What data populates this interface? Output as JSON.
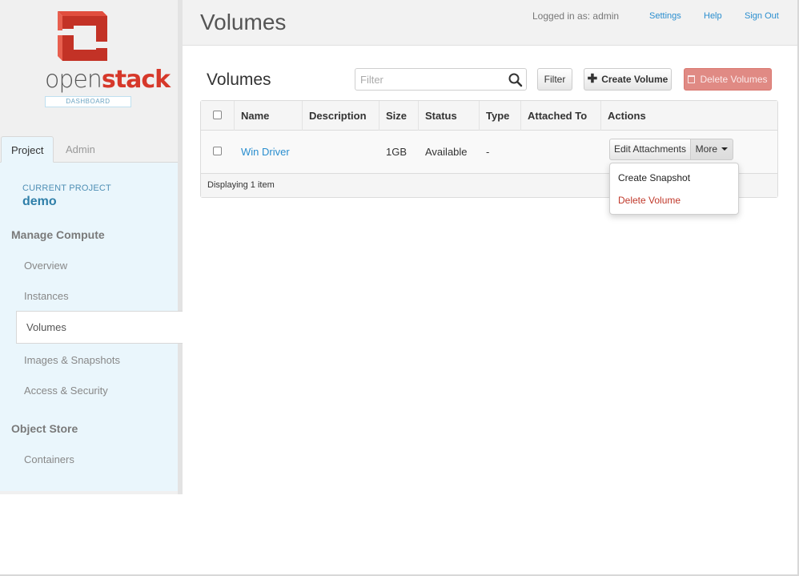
{
  "brand": {
    "logo_word_open": "open",
    "logo_word_stack": "stack",
    "logo_sub": "DASHBOARD",
    "brand_red": "#d6382a"
  },
  "sidebar": {
    "tabs": [
      {
        "label": "Project",
        "active": true
      },
      {
        "label": "Admin",
        "active": false
      }
    ],
    "current_project_label": "CURRENT PROJECT",
    "current_project_name": "demo",
    "sections": [
      {
        "title": "Manage Compute",
        "items": [
          {
            "label": "Overview",
            "active": false
          },
          {
            "label": "Instances",
            "active": false
          },
          {
            "label": "Volumes",
            "active": true
          },
          {
            "label": "Images & Snapshots",
            "active": false
          },
          {
            "label": "Access & Security",
            "active": false
          }
        ]
      },
      {
        "title": "Object Store",
        "items": [
          {
            "label": "Containers",
            "active": false
          }
        ]
      }
    ]
  },
  "header": {
    "title": "Volumes",
    "logged_in": "Logged in as: admin",
    "links": {
      "settings": "Settings",
      "help": "Help",
      "sign_out": "Sign Out"
    }
  },
  "main": {
    "table_title": "Volumes",
    "filter_placeholder": "Filter",
    "filter_button": "Filter",
    "create_button": "Create Volume",
    "delete_button": "Delete Volumes",
    "columns": [
      "Name",
      "Description",
      "Size",
      "Status",
      "Type",
      "Attached To",
      "Actions"
    ],
    "rows": [
      {
        "name": "Win Driver",
        "description": "",
        "size": "1GB",
        "status": "Available",
        "type": "-",
        "attached_to": ""
      }
    ],
    "row_actions": {
      "primary": "Edit Attachments",
      "more": "More",
      "menu": [
        "Create Snapshot",
        "Delete Volume"
      ]
    },
    "footer": "Displaying 1 item"
  }
}
